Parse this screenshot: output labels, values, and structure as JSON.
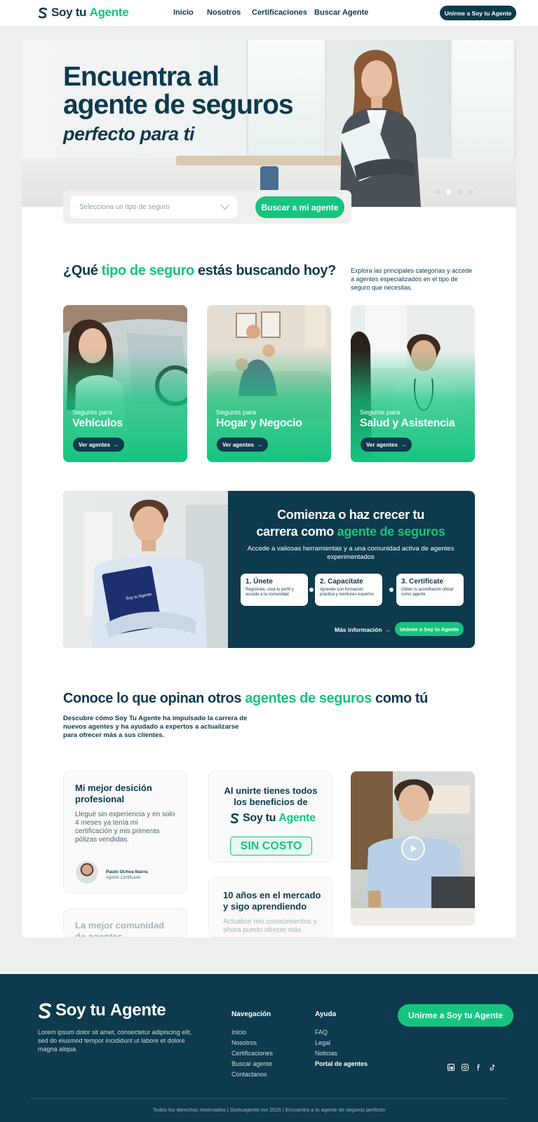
{
  "brand": {
    "part1": "Soy tu",
    "part2": "Agente"
  },
  "nav": [
    "Inicio",
    "Nosotros",
    "Certificaciones",
    "Buscar Agente"
  ],
  "header_button": "Unirme a Soy tu Agente",
  "hero": {
    "title_line1": "Encuentra al",
    "title_line2": "agente de seguros",
    "subtitle": "perfecto para ti",
    "select_placeholder": "Selecciona un tipo de seguro",
    "search_button": "Buscar a mi agente",
    "slide_count": 4,
    "active_slide": 1
  },
  "section1": {
    "title_a": "¿Qué ",
    "title_b": "tipo de seguro",
    "title_c": " estás buscando hoy?",
    "description": "Explora las principales categorías y accede a agentes especializados en el tipo de seguro que necesitas."
  },
  "categories": [
    {
      "pre": "Seguros para",
      "name": "Vehículos",
      "button": "Ver agentes"
    },
    {
      "pre": "Seguros para",
      "name": "Hogar y Negocio",
      "button": "Ver agentes"
    },
    {
      "pre": "Seguros para",
      "name": "Salud y Asistencia",
      "button": "Ver agentes"
    }
  ],
  "career": {
    "title_a": "Comienza o haz crecer tu",
    "title_b": "carrera como ",
    "title_c": "agente de seguros",
    "description": "Accede a valiosas herramientas y a una comunidad activa de agentes experimentados",
    "steps": [
      {
        "title": "1. Únete",
        "desc": "Regístrate, crea tu perfil y accede a la comunidad"
      },
      {
        "title": "2. Capacítate",
        "desc": "Aprende con formación práctica y mentores expertos"
      },
      {
        "title": "3. Certifícate",
        "desc": "Obtén tu acreditación oficial como agente"
      }
    ],
    "more_link": "Más información",
    "join_button": "Unirme a Soy tu Agente",
    "clipboard_text": "Soy tu Agente"
  },
  "section2": {
    "title_a": "Conoce lo que opinan otros ",
    "title_b": "agentes de seguros",
    "title_c": " como tú",
    "description": "Descubre cómo Soy Tu Agente ha impulsado la carrera de nuevos agentes y ha ayudado a expertos a actualizarse para ofrecer más a sus clientes."
  },
  "testimonials": {
    "t1_title": "Mi mejor desición profesional",
    "t1_body": "Llegué sin experiencia y en solo 4 meses ya tenía mi certificación y mis primeras pólizas vendidas.",
    "t1_person": "Paulo Ochoa Ibarra",
    "t1_role": "Agente Certificado",
    "t2_title": "Al unirte tienes todos los beneficios de",
    "t2_badge": "SIN COSTO",
    "t3_title": "10 años en el mercado y sigo aprendiendo",
    "t3_body": "Actualicé mis conocimientos y ahora puedo ofrecer más",
    "t4_title": "La mejor comunidad de agentes"
  },
  "footer": {
    "description": "Lorem ipsum dolor sit amet, consectetur adipiscing elit, sed do eiusmod tempor incididunt ut labore et dolore magna aliqua.",
    "nav_title": "Navegación",
    "nav_links": [
      "Inicio",
      "Nosotros",
      "Certificaciones",
      "Buscar agente",
      "Contactanos"
    ],
    "help_title": "Ayuda",
    "help_links": [
      "FAQ",
      "Legal",
      "Noticias",
      "Portal de agentes"
    ],
    "join_button": "Unirme a Soy tu Agente",
    "social": [
      "linkedin-icon",
      "instagram-icon",
      "facebook-icon",
      "tiktok-icon"
    ],
    "copyright": "Todos los derechos reservados | Soytuagente.mx 2025 | Encuentra a tu agente de seguros perfecto"
  },
  "colors": {
    "navy": "#0d3a4d",
    "green": "#16c47f",
    "background": "#eef0ef"
  }
}
